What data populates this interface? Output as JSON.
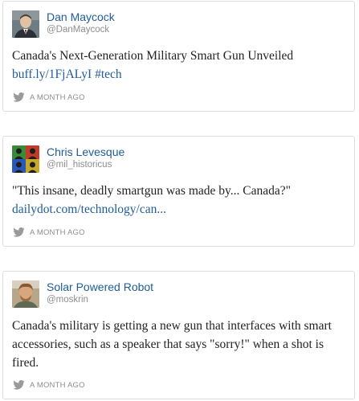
{
  "tweets": [
    {
      "name": "Dan Maycock",
      "handle": "@DanMaycock",
      "text": "Canada's Next-Generation Military Smart Gun Unveiled",
      "links": [
        "buff.ly/1FjALyI",
        "#tech"
      ],
      "time": "A MONTH AGO",
      "avatar_icon": "user-avatar-photo"
    },
    {
      "name": "Chris Levesque",
      "handle": "@mil_historicus",
      "text": "\"This insane, deadly smartgun was made by... Canada?\"",
      "links": [
        "dailydot.com/technology/can..."
      ],
      "time": "A MONTH AGO",
      "avatar_icon": "user-avatar-photo"
    },
    {
      "name": "Solar Powered Robot",
      "handle": "@moskrin",
      "text": "Canada's military is getting a new gun that interfaces with smart accessories, such as a speaker that says \"sorry!\" when a shot is fired.",
      "time": "A MONTH AGO",
      "avatar_icon": "user-avatar-photo"
    }
  ],
  "colors": {
    "link": "#1f5c99",
    "meta": "#8d8d8d",
    "border": "#dcdcdc",
    "text": "#222222"
  },
  "icons": {
    "footer": "twitter-bird-icon"
  }
}
